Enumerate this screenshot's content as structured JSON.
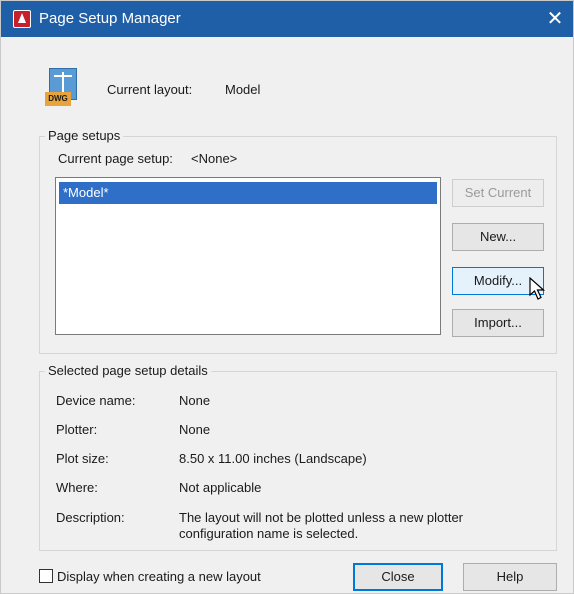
{
  "window": {
    "title": "Page Setup Manager",
    "close_glyph": "✕"
  },
  "header": {
    "icon_tag": "DWG",
    "current_layout_label": "Current layout:",
    "current_layout_value": "Model"
  },
  "page_setups": {
    "group_title": "Page setups",
    "current_page_setup_label": "Current page setup:",
    "current_page_setup_value": "<None>",
    "items": [
      "*Model*"
    ],
    "buttons": {
      "set_current": "Set Current",
      "new": "New...",
      "modify": "Modify...",
      "import": "Import..."
    }
  },
  "details": {
    "group_title": "Selected page setup details",
    "rows": [
      {
        "label": "Device name:",
        "value": "None"
      },
      {
        "label": "Plotter:",
        "value": "None"
      },
      {
        "label": "Plot size:",
        "value": "8.50 x 11.00 inches (Landscape)"
      },
      {
        "label": "Where:",
        "value": "Not applicable"
      },
      {
        "label": "Description:",
        "value": "The layout will not be plotted unless a new plotter",
        "value2": "configuration name is selected."
      }
    ]
  },
  "footer": {
    "checkbox_label": "Display when creating a new layout",
    "close_label": "Close",
    "help_label": "Help"
  },
  "colors": {
    "titlebar": "#1f5fa8",
    "selection": "#2f6fc7",
    "accent": "#0078d7"
  },
  "icons": {
    "app": "autocad-icon",
    "file": "dwg-file-icon",
    "cursor": "mouse-pointer-icon"
  }
}
